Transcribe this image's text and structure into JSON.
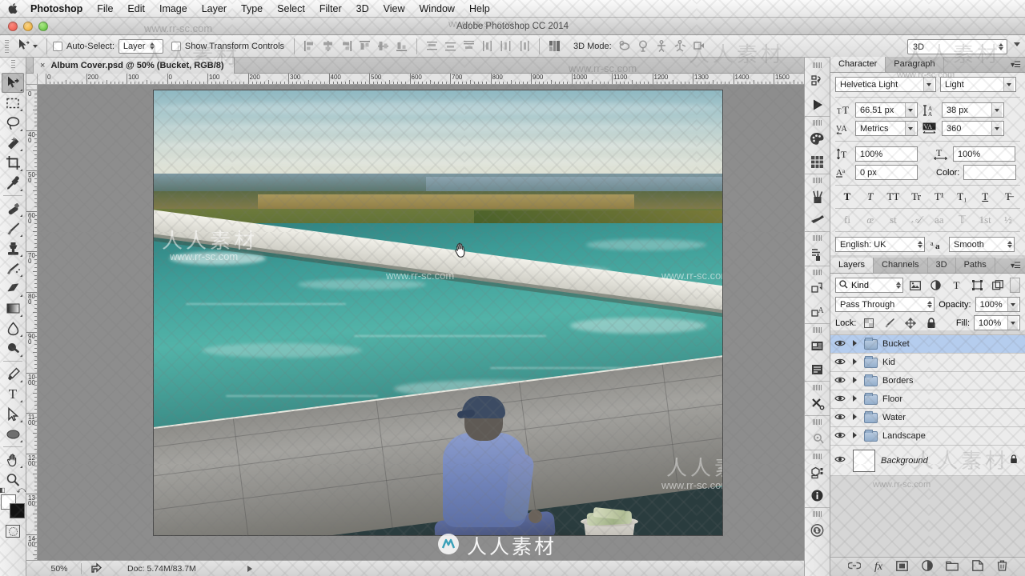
{
  "menubar": {
    "apple_icon": "apple-logo",
    "items": [
      "Photoshop",
      "File",
      "Edit",
      "Image",
      "Layer",
      "Type",
      "Select",
      "Filter",
      "3D",
      "View",
      "Window",
      "Help"
    ]
  },
  "titlebar": {
    "title": "Adobe Photoshop CC 2014"
  },
  "options_bar": {
    "tool_icon": "move-tool-icon",
    "auto_select_label": "Auto-Select:",
    "auto_select_checked": false,
    "auto_select_value": "Layer",
    "show_transform_label": "Show Transform Controls",
    "show_transform_checked": false,
    "align_icons": [
      "align-left-edges-icon",
      "align-horizontal-centers-icon",
      "align-right-edges-icon",
      "align-top-edges-icon",
      "align-vertical-centers-icon",
      "align-bottom-edges-icon",
      "distribute-top-icon",
      "distribute-vertical-center-icon",
      "distribute-bottom-icon",
      "distribute-left-icon",
      "distribute-horizontal-center-icon",
      "distribute-right-icon",
      "auto-align-layers-icon"
    ],
    "mode_3d_label": "3D Mode:",
    "mode_3d_icons": [
      "rotate-3d-icon",
      "roll-3d-icon",
      "drag-3d-icon",
      "slide-3d-icon",
      "scale-3d-icon"
    ],
    "workspace_value": "3D"
  },
  "toolbox": {
    "tools": [
      {
        "name": "move-tool",
        "glyph": "➤",
        "active": true
      },
      {
        "name": "rectangular-marquee-tool",
        "glyph": "⬚",
        "active": false
      },
      {
        "name": "lasso-tool",
        "glyph": "○",
        "active": false
      },
      {
        "name": "magic-wand-tool",
        "glyph": "✦",
        "active": false
      },
      {
        "name": "crop-tool",
        "glyph": "⌗",
        "active": false
      },
      {
        "name": "eyedropper-tool",
        "glyph": "✎",
        "active": false
      },
      {
        "name": "spot-healing-brush-tool",
        "glyph": "✒",
        "active": false
      },
      {
        "name": "brush-tool",
        "glyph": "✐",
        "active": false
      },
      {
        "name": "clone-stamp-tool",
        "glyph": "⚑",
        "active": false
      },
      {
        "name": "history-brush-tool",
        "glyph": "✄",
        "active": false
      },
      {
        "name": "eraser-tool",
        "glyph": "▰",
        "active": false
      },
      {
        "name": "gradient-tool",
        "glyph": "▧",
        "active": false
      },
      {
        "name": "blur-tool",
        "glyph": "●",
        "active": false
      },
      {
        "name": "dodge-tool",
        "glyph": "⚲",
        "active": false
      },
      {
        "name": "pen-tool",
        "glyph": "✒",
        "active": false
      },
      {
        "name": "horizontal-type-tool",
        "glyph": "T",
        "active": false
      },
      {
        "name": "path-selection-tool",
        "glyph": "➤",
        "active": false
      },
      {
        "name": "ellipse-tool",
        "glyph": "⬭",
        "active": false
      },
      {
        "name": "hand-tool",
        "glyph": "✋",
        "active": false
      },
      {
        "name": "zoom-tool",
        "glyph": "⌕",
        "active": false
      }
    ],
    "foreground_color": "#ffffff",
    "background_color": "#111111",
    "quick_mask_name": "quick-mask-toggle"
  },
  "document": {
    "tab_title": "Album Cover.psd @ 50% (Bucket, RGB/8)",
    "close_glyph": "×",
    "ruler_h_ticks": [
      "0",
      "200",
      "100",
      "0",
      "100",
      "200",
      "300",
      "400",
      "500",
      "600",
      "700",
      "800",
      "900",
      "1000",
      "1100",
      "1200",
      "1300",
      "1400",
      "1500"
    ],
    "ruler_v_ticks": [
      "0",
      "400",
      "500",
      "600",
      "700",
      "800",
      "900",
      "1000",
      "1100",
      "1200",
      "1300",
      "1400"
    ]
  },
  "statusbar": {
    "zoom": "50%",
    "share_icon": "share-icon",
    "doc_info": "Doc: 5.74M/83.7M",
    "expand_icon": "expand-arrow-icon"
  },
  "rail": {
    "buttons": [
      "history-icon",
      "play-action-icon",
      "swatches-palette-icon",
      "color-grid-icon",
      "brush-presets-icon",
      "tool-presets-icon",
      "adjustments-icon",
      "layer-comps-icon",
      "character-styles-icon",
      "notes-icon",
      "properties-icon",
      "timeline-icon",
      "measurement-log-icon",
      "3d-panel-icon",
      "info-icon",
      "link-icon"
    ]
  },
  "character_panel": {
    "tabs": [
      {
        "label": "Character",
        "active": true
      },
      {
        "label": "Paragraph",
        "active": false
      }
    ],
    "menu_icon": "panel-menu-icon",
    "font_family": "Helvetica Light",
    "font_style": "Light",
    "font_size_icon": "font-size-icon",
    "font_size": "66.51 px",
    "leading_icon": "leading-icon",
    "leading": "38 px",
    "kerning_icon": "kerning-icon",
    "kerning": "Metrics",
    "tracking_icon": "tracking-icon",
    "tracking": "360",
    "vertical_scale_icon": "vertical-scale-icon",
    "vertical_scale": "100%",
    "horizontal_scale_icon": "horizontal-scale-icon",
    "horizontal_scale": "100%",
    "baseline_shift_icon": "baseline-shift-icon",
    "baseline_shift": "0 px",
    "color_label": "Color:",
    "color_value": "#ffffff",
    "style_glyphs": [
      "T",
      "T",
      "TT",
      "Tr",
      "T¹",
      "T₁",
      "T",
      "T̶"
    ],
    "style_glyph_names": [
      "faux-bold",
      "faux-italic",
      "all-caps",
      "small-caps",
      "superscript",
      "subscript",
      "underline",
      "strikethrough"
    ],
    "opentype_glyphs": [
      "fi",
      "œ",
      "st",
      "𝒜",
      "aa",
      "𝕋",
      "1st",
      "½"
    ],
    "opentype_names": [
      "standard-ligatures",
      "discretionary-ligatures",
      "contextual-alternates",
      "swash",
      "stylistic-alternates",
      "titling-alternates",
      "ordinals",
      "fractions"
    ],
    "language": "English: UK",
    "antialias_icon": "anti-alias-icon",
    "antialias": "Smooth"
  },
  "layers_panel": {
    "tabs": [
      {
        "label": "Layers",
        "active": true
      },
      {
        "label": "Channels",
        "active": false
      },
      {
        "label": "3D",
        "active": false
      },
      {
        "label": "Paths",
        "active": false
      }
    ],
    "menu_icon": "panel-menu-icon",
    "filter_kind": "Kind",
    "filter_search_icon": "search-icon",
    "filter_icons": [
      "filter-pixel-icon",
      "filter-adjustment-icon",
      "filter-type-icon",
      "filter-shape-icon",
      "filter-smart-object-icon"
    ],
    "blend_mode": "Pass Through",
    "opacity_label": "Opacity:",
    "opacity": "100%",
    "lock_label": "Lock:",
    "lock_icons": [
      "lock-transparent-pixels-icon",
      "lock-image-pixels-icon",
      "lock-position-icon",
      "lock-all-icon"
    ],
    "fill_label": "Fill:",
    "fill": "100%",
    "layers": [
      {
        "name": "Bucket",
        "type": "group",
        "visible": true,
        "selected": true
      },
      {
        "name": "Kid",
        "type": "group",
        "visible": true,
        "selected": false
      },
      {
        "name": "Borders",
        "type": "group",
        "visible": true,
        "selected": false
      },
      {
        "name": "Floor",
        "type": "group",
        "visible": true,
        "selected": false
      },
      {
        "name": "Water",
        "type": "group",
        "visible": true,
        "selected": false
      },
      {
        "name": "Landscape",
        "type": "group",
        "visible": true,
        "selected": false
      },
      {
        "name": "Background",
        "type": "layer",
        "visible": true,
        "selected": false,
        "locked": true
      }
    ],
    "footer_icons": [
      "link-layers-icon",
      "layer-style-icon",
      "layer-mask-icon",
      "new-fill-adjustment-icon",
      "new-group-icon",
      "new-layer-icon",
      "delete-layer-icon"
    ]
  },
  "watermarks": {
    "site": "www.rr-sc.com",
    "cn": "人人素材",
    "logo_text": "人人素材"
  },
  "canvas": {
    "cursor_icon": "hand-cursor-icon",
    "artboard_description": "composite photo of a boy sitting on a concrete deck beside turquoise rushing water with a bucket of money, landscape and sky behind"
  },
  "colors": {
    "selection_blue": "#b5cdee",
    "panel_bg": "#ececec",
    "chrome": "#d6d6d6"
  }
}
